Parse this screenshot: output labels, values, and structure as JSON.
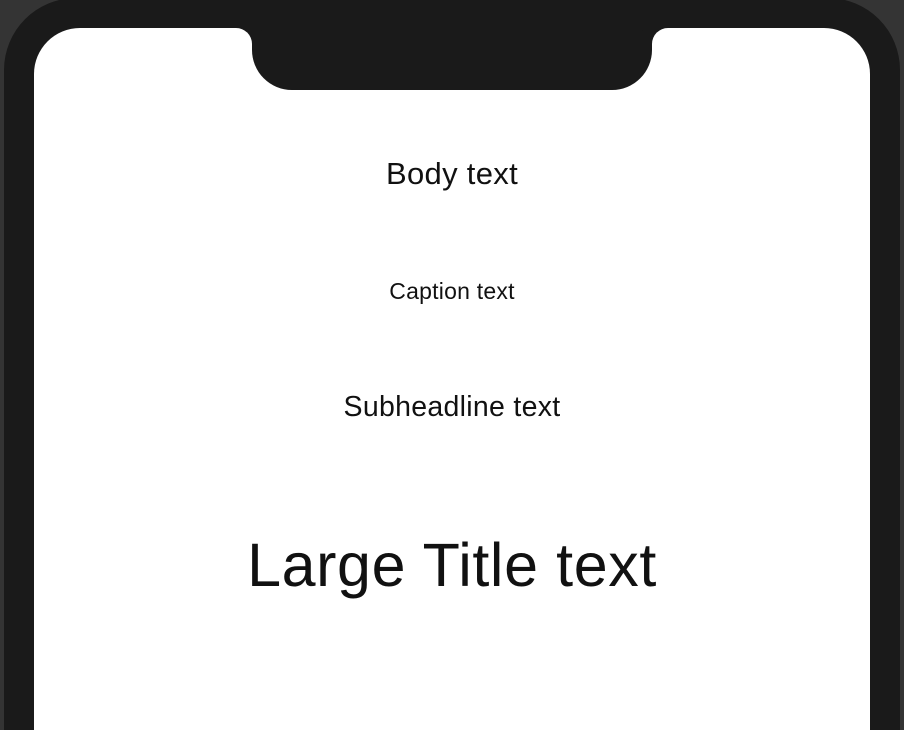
{
  "typography": {
    "body": "Body text",
    "caption": "Caption text",
    "subheadline": "Subheadline text",
    "largeTitle": "Large Title text"
  }
}
